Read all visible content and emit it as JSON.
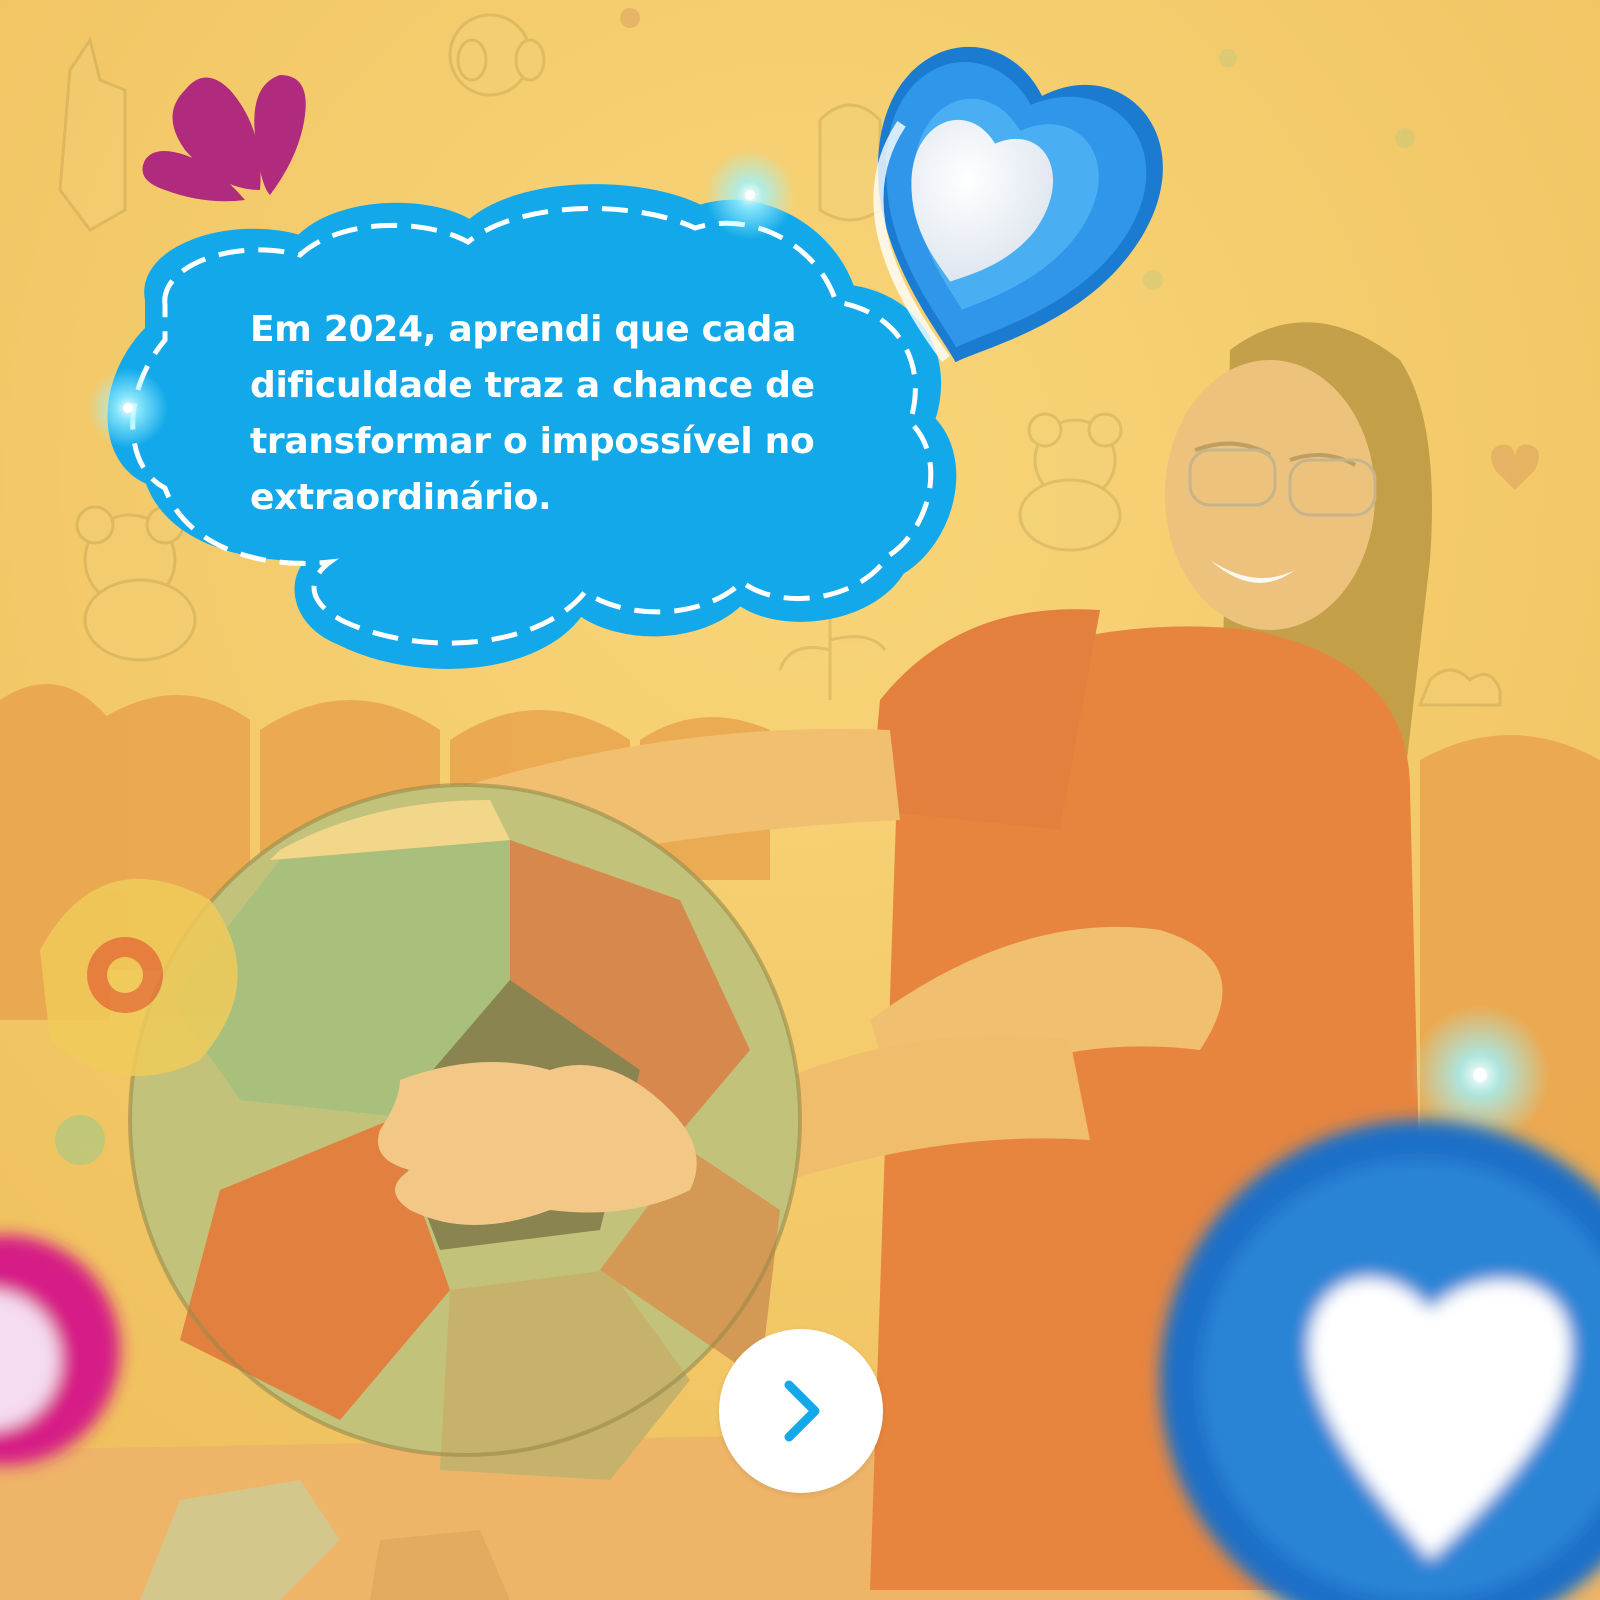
{
  "post": {
    "quote": "Em 2024, aprendi que cada dificuldade traz a chance de transformar o impossível no extraordinário."
  },
  "navigation": {
    "next_icon": "chevron-right-icon"
  },
  "colors": {
    "background": "#f2c86a",
    "speech_bubble": "#12a8e9",
    "accent_magenta": "#b02a7e",
    "heart_blue": "#1a7bd0",
    "text": "#ffffff"
  }
}
